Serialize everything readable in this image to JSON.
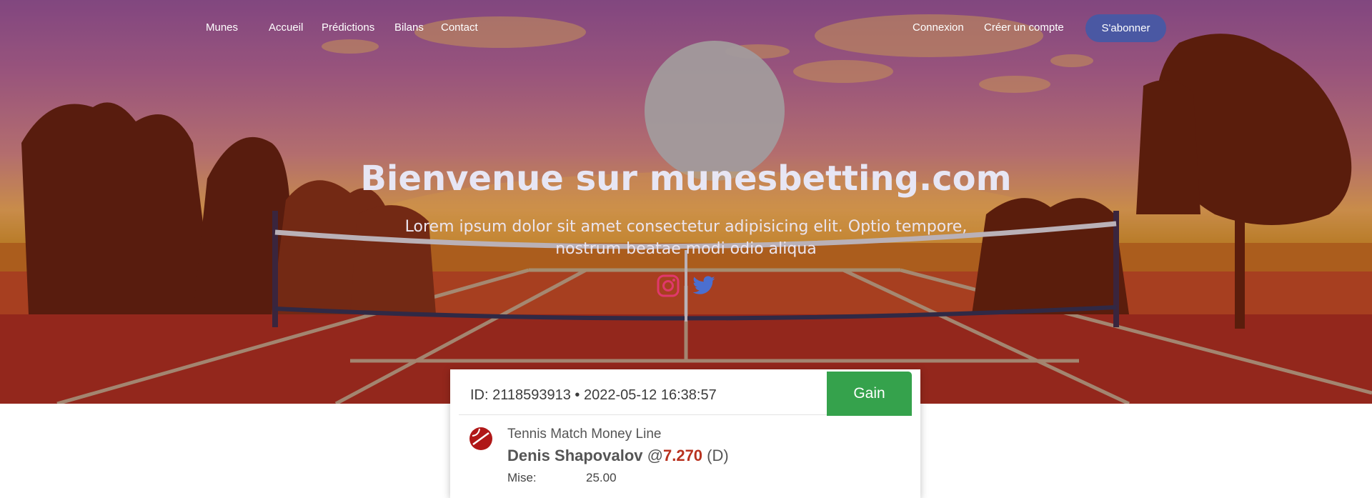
{
  "nav": {
    "brand": "Munes",
    "links": [
      "Accueil",
      "Prédictions",
      "Bilans",
      "Contact"
    ],
    "login": "Connexion",
    "register": "Créer un compte",
    "subscribe": "S'abonner"
  },
  "hero": {
    "title": "Bienvenue sur munesbetting.com",
    "subtitle": "Lorem ipsum dolor sit amet consectetur adipisicing elit. Optio tempore, nostrum beatae modi odio aliqua",
    "social_icons": [
      "instagram-icon",
      "twitter-icon"
    ]
  },
  "bet_card": {
    "id_line": "ID: 2118593913 • 2022-05-12 16:38:57",
    "status": "Gain",
    "market": "Tennis Match Money Line",
    "player": "Denis Shapovalov",
    "at": "@",
    "odds": "7.270",
    "side": "(D)",
    "stake_label": "Mise:",
    "stake_value": "25.00"
  },
  "colors": {
    "subscribe": "#4a58a3",
    "gain": "#35a24c",
    "odds": "#b8321f",
    "instagram": "#e0386b",
    "twitter": "#4b6fd0"
  }
}
